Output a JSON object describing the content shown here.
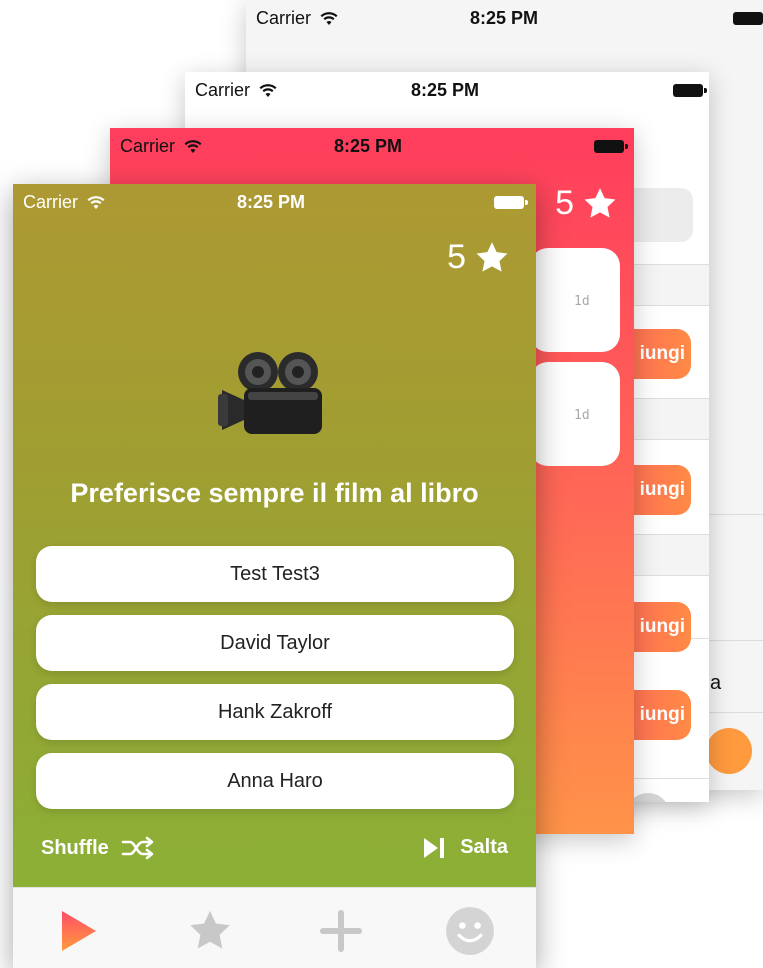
{
  "statusbar": {
    "carrier": "Carrier",
    "time": "8:25 PM"
  },
  "back_screen": {
    "partial_label": "a"
  },
  "list_screen": {
    "add_label": "iungi",
    "add_buttons": 4
  },
  "ranking_screen": {
    "points": "5",
    "cards": [
      {
        "age": "1d"
      },
      {
        "age": "1d"
      }
    ]
  },
  "game": {
    "points": "5",
    "question": "Preferisce sempre il film al libro",
    "options": [
      {
        "label": "Test Test3"
      },
      {
        "label": "David Taylor"
      },
      {
        "label": "Hank Zakroff"
      },
      {
        "label": "Anna Haro"
      }
    ],
    "shuffle_label": "Shuffle",
    "skip_label": "Salta"
  },
  "tabs": [
    "play-icon",
    "star-icon",
    "plus-icon",
    "smile-icon"
  ],
  "colors": {
    "accent": "#ff4f6a",
    "game_bg_top": "#ad9933",
    "game_bg_bottom": "#88b536",
    "tab_inactive": "#c8c8c8"
  }
}
